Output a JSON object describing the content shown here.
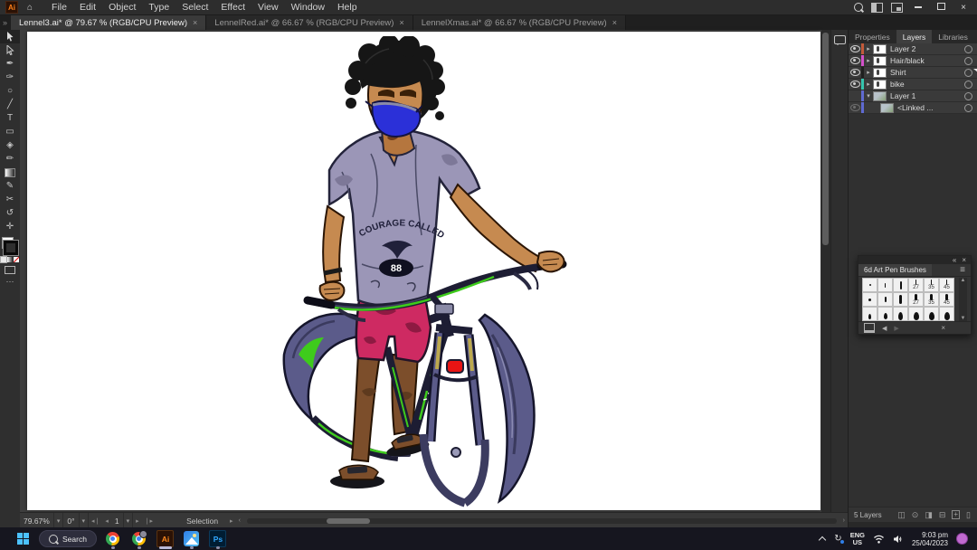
{
  "menu": {
    "items": [
      "File",
      "Edit",
      "Object",
      "Type",
      "Select",
      "Effect",
      "View",
      "Window",
      "Help"
    ]
  },
  "tabs": {
    "items": [
      {
        "title": "Lennel3.ai* @ 79.67 % (RGB/CPU Preview)",
        "active": true
      },
      {
        "title": "LennelRed.ai* @ 66.67 % (RGB/CPU Preview)",
        "active": false
      },
      {
        "title": "LennelXmas.ai* @ 66.67 % (RGB/CPU Preview)",
        "active": false
      }
    ]
  },
  "panels": {
    "tabs": [
      "Properties",
      "Layers",
      "Libraries"
    ],
    "active_tab": "Layers",
    "layers": {
      "rows": [
        {
          "name": "Layer 2",
          "color": "#c25a3a",
          "eye": "on",
          "expanded": false
        },
        {
          "name": "Hair/black",
          "color": "#d351c9",
          "eye": "on",
          "expanded": false
        },
        {
          "name": "Shirt",
          "color": "#1f1f1f",
          "eye": "on",
          "expanded": false,
          "selected": true
        },
        {
          "name": "bike",
          "color": "#35c4ae",
          "eye": "on",
          "expanded": false
        },
        {
          "name": "Layer 1",
          "color": "#5f6ad1",
          "eye": "off",
          "expanded": true
        },
        {
          "name": "<Linked ...",
          "color": "#5f6ad1",
          "eye": "dim",
          "child": true
        }
      ],
      "footer_count": "5 Layers"
    }
  },
  "brushes": {
    "title": "6d Art Pen Brushes",
    "cell_labels": [
      "",
      "",
      "",
      "27",
      "35",
      "45",
      "",
      "",
      "",
      "27",
      "35",
      "45",
      "",
      "",
      "",
      "",
      "",
      ""
    ]
  },
  "statusbar": {
    "zoom": "79.67%",
    "rotation": "0°",
    "artboard_number": "1",
    "mode": "Selection"
  },
  "taskbar": {
    "search_placeholder": "Search",
    "lang_top": "ENG",
    "lang_bottom": "US",
    "time": "9:03 pm",
    "date": "25/04/2023"
  },
  "artwork": {
    "shirt_text": "COURAGE CALLED",
    "shirt_number": "88",
    "colors": {
      "skin": "#c68a50",
      "skin_dark": "#7c4e2b",
      "mask_blue": "#2b30d8",
      "shirt_gray": "#9b96b7",
      "shorts_pink": "#ce2a62",
      "hair_black": "#161616",
      "bike_frame": "#1d1d33",
      "bike_green": "#3ecb1c",
      "wheel_slate": "#5b5b8a",
      "reflector_red": "#e81414"
    }
  },
  "icons": {
    "close": "×",
    "tab_close": "×",
    "collapse_left": "«",
    "chevron_double_right": "»",
    "panel_menu": "≡"
  }
}
